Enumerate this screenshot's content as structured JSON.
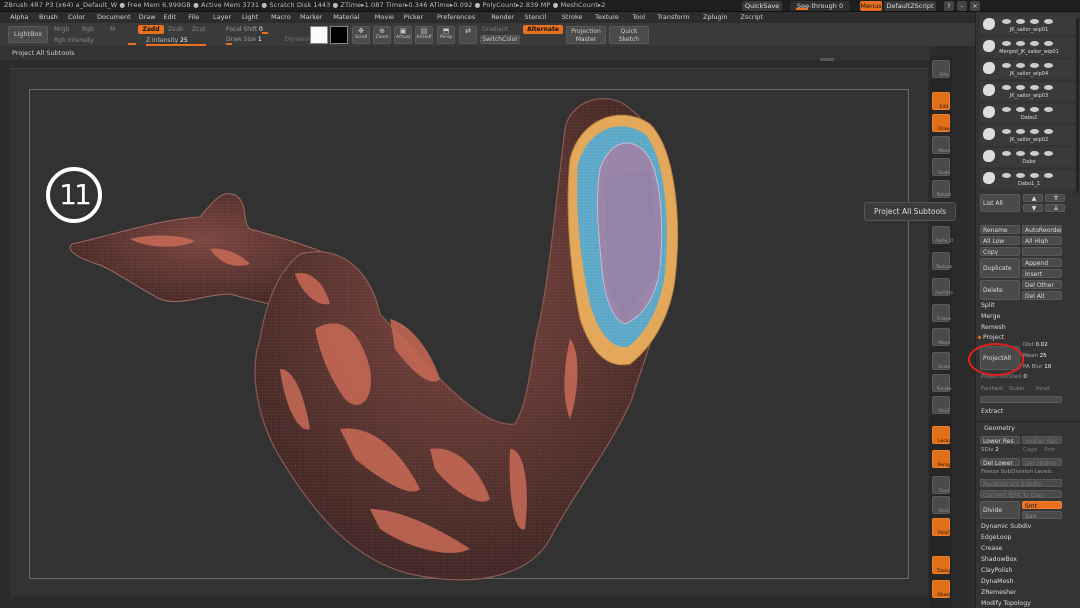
{
  "titlebar": {
    "text": "ZBrush 4R7 P3 (x64)    a_Default_W    ● Free Mem 6.999GB ● Active Mem 3731 ● Scratch Disk 1443 ● ZTime▸1.087 Timer▸0.346 ATime▸0.092 ● PolyCount▸2.839 MP ● MeshCount▸2",
    "quicksave": "QuickSave",
    "seethrough": "See-through",
    "seethrough_value": "0",
    "menus": "Menus",
    "defaultzscript": "DefaultZScript"
  },
  "menubar": [
    "Alpha",
    "Brush",
    "Color",
    "Document",
    "Draw",
    "Edit",
    "File",
    "Layer",
    "Light",
    "Macro",
    "Marker",
    "Material",
    "Movie",
    "Picker",
    "Preferences",
    "Render",
    "Stencil",
    "Stroke",
    "Texture",
    "Tool",
    "Transform",
    "Zplugin",
    "Zscript"
  ],
  "toolbar": {
    "lightbox": "LightBox",
    "mrgb": "Mrgb",
    "rgb": "Rgb",
    "m": "M",
    "zadd": "Zadd",
    "zsub": "Zsub",
    "zcut": "Zcut",
    "rgb_intensity": "Rgb Intensity",
    "z_intensity": "Z Intensity",
    "z_intensity_value": "25",
    "focal_shift": "Focal Shift",
    "focal_shift_value": "0",
    "draw_size": "Draw Size",
    "draw_size_value": "1",
    "dynamic": "Dynamic",
    "scroll": "Scroll",
    "zoom": "Zoom",
    "actual": "Actual",
    "aahalf": "AAHalf",
    "persp": "Persp",
    "gradient": "Gradient",
    "switchcolor": "SwitchColor",
    "alternate": "Alternate",
    "projection_master": "Projection Master",
    "quick_sketch": "Quick Sketch"
  },
  "docbar": {
    "label": "Project All Subtools"
  },
  "viewport": {
    "step_number": "11"
  },
  "tooltip": "Project All Subtools",
  "shelf": [
    {
      "label": "SPix"
    },
    {
      "label": "Edit"
    },
    {
      "label": "Draw"
    },
    {
      "label": "Move"
    },
    {
      "label": "Scale"
    },
    {
      "label": "Rotate"
    },
    {
      "label": "Dots"
    },
    {
      "label": "Alpha_O"
    },
    {
      "label": "Texture"
    },
    {
      "label": "FastSha"
    },
    {
      "label": "Frame"
    },
    {
      "label": "Move"
    },
    {
      "label": "Scale"
    },
    {
      "label": "Rotate"
    },
    {
      "label": "PolyF"
    },
    {
      "label": "Local"
    },
    {
      "label": "Persp"
    },
    {
      "label": "Floor"
    },
    {
      "label": "Rect"
    },
    {
      "label": "PolyF"
    },
    {
      "label": "Transp"
    },
    {
      "label": "Ghost"
    }
  ],
  "subtools": [
    {
      "name": "JK_sailor_wip01"
    },
    {
      "name": "Merged_JK_sailor_wip01"
    },
    {
      "name": "JK_sailor_wip04"
    },
    {
      "name": "JK_sailor_wip03"
    },
    {
      "name": "Dabo2"
    },
    {
      "name": "JK_sailor_wip02"
    },
    {
      "name": "Dabo"
    },
    {
      "name": "Dabo1_1"
    }
  ],
  "panel": {
    "list_all": "List All",
    "rename": "Rename",
    "autoreorder": "AutoReorder",
    "all_low": "All Low",
    "all_high": "All High",
    "copy": "Copy",
    "duplicate": "Duplicate",
    "append": "Append",
    "insert": "Insert",
    "delete": "Delete",
    "del_other": "Del Other",
    "del_all": "Del All",
    "split": "Split",
    "merge": "Merge",
    "remesh": "Remesh",
    "project": "Project",
    "projectall": "ProjectAll",
    "dist": "Dist",
    "dist_value": "0.02",
    "mean": "Mean",
    "mean_value": "25",
    "pa_blur": "PA Blur",
    "pa_blur_value": "10",
    "projection_shell": "ProjectionShell",
    "projection_shell_value": "0",
    "farthest": "Farthest",
    "outer": "Outer",
    "inner": "Inner",
    "extract": "Extract",
    "geometry": "Geometry",
    "lower_res": "Lower Res",
    "higher_res": "Higher Res",
    "sdiv": "SDiv",
    "sdiv_value": "2",
    "cage": "Cage",
    "rstr": "Rstr",
    "del_lower": "Del Lower",
    "del_higher": "Del Higher",
    "freeze": "Freeze SubDivision Levels",
    "reconstruct": "Reconstruct Subdiv",
    "convert_bpr": "Convert BPR To Geo",
    "divide": "Divide",
    "smt": "Smt",
    "suv": "Suv",
    "dynamic_subdiv": "Dynamic Subdiv",
    "edgeloop": "EdgeLoop",
    "crease": "Crease",
    "shadowbox": "ShadowBox",
    "claypolish": "ClayPolish",
    "dynamesh": "DynaMesh",
    "zremesher": "ZRemesher",
    "modify_topology": "Modify Topology"
  },
  "colors": {
    "accent": "#e87020",
    "highlight": "#e02020"
  }
}
